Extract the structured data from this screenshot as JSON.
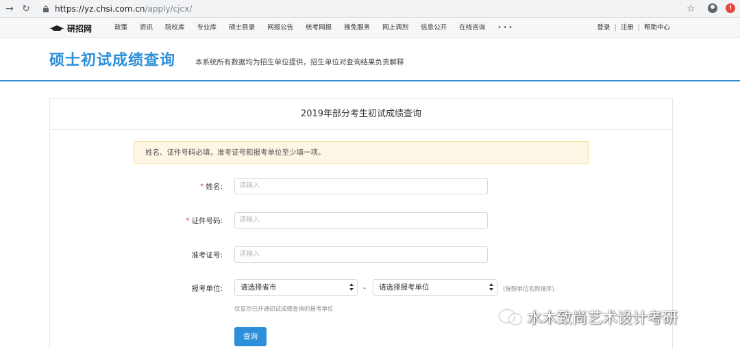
{
  "browser": {
    "url_host": "https://yz.chsi.com.cn",
    "url_path": "/apply/cjcx/",
    "icons": [
      "back-arrow-icon",
      "reload-icon",
      "lock-icon",
      "star-icon",
      "account-icon",
      "extension-icon"
    ]
  },
  "topnav": {
    "logo_text": "研招网",
    "items": [
      "政策",
      "资讯",
      "院校库",
      "专业库",
      "硕士目录",
      "网报公告",
      "统考网报",
      "推免服务",
      "网上调剂",
      "信息公开",
      "在线咨询"
    ],
    "more": "•••",
    "login": "登录",
    "register": "注册",
    "help": "帮助中心",
    "separator": "|"
  },
  "header": {
    "title": "硕士初试成绩查询",
    "subtitle": "本系统所有数据均为招生单位提供，招生单位对查询结果负责解释"
  },
  "card": {
    "title": "2019年部分考生初试成绩查询",
    "alert": "姓名、证件号码必填，准考证号和报考单位至少填一项。"
  },
  "form": {
    "required_mark": "*",
    "name_label": "姓名:",
    "id_label": "证件号码:",
    "ticket_label": "准考证号:",
    "unit_label": "报考单位:",
    "placeholder": "请输入",
    "province_select": "请选择省市",
    "unit_select": "请选择报考单位",
    "dash": "-",
    "sort_hint": "(按照单位名称排序)",
    "help_text": "仅显示已开通初试成绩查询的报考单位",
    "submit_label": "查询"
  },
  "watermark": {
    "text": "水木致尚艺术设计考研"
  }
}
